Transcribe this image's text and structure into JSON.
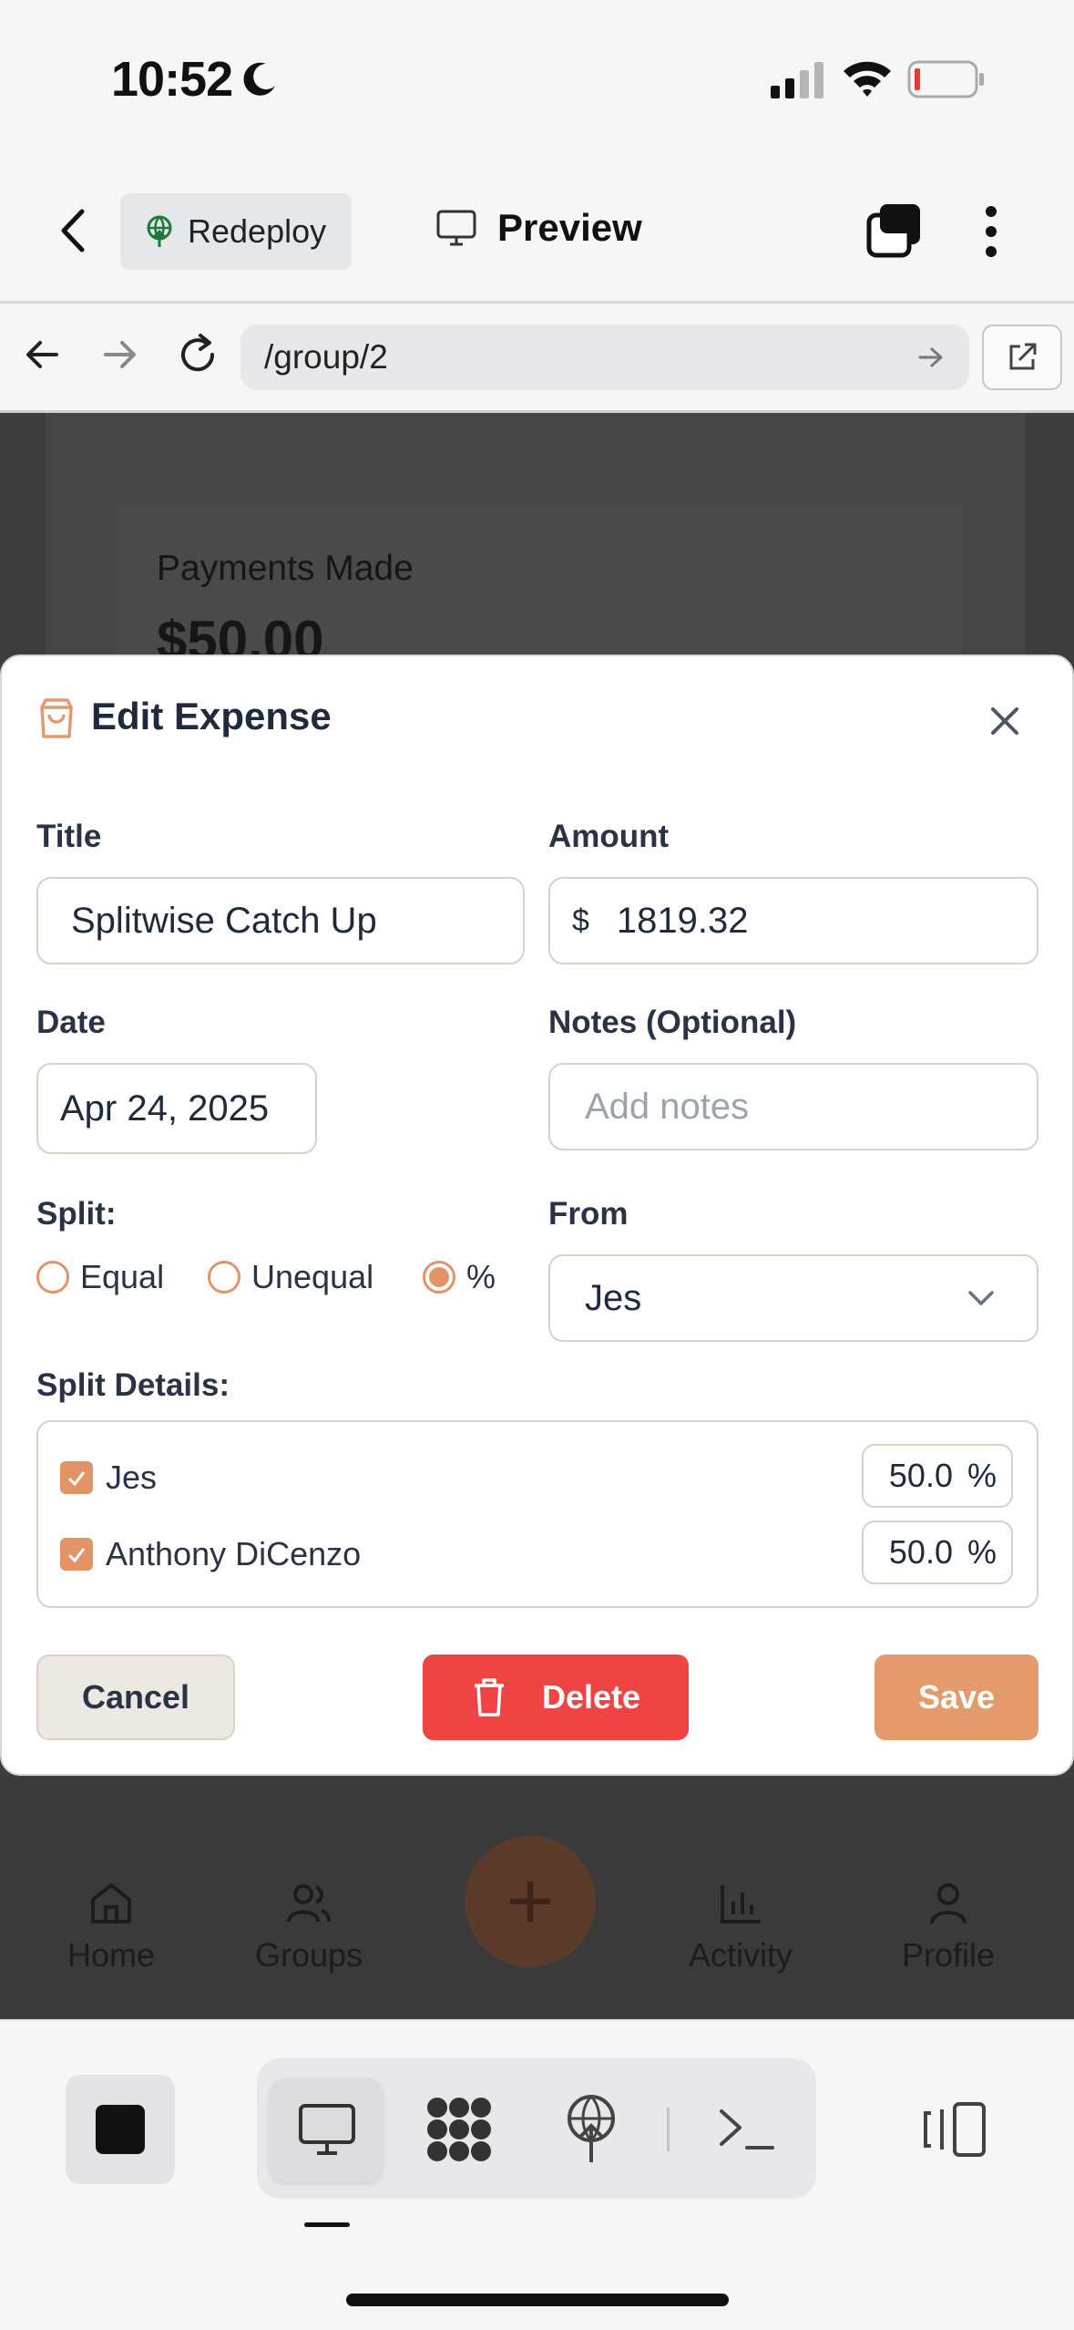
{
  "status": {
    "time": "10:52"
  },
  "header": {
    "redeploy_label": "Redeploy",
    "preview_label": "Preview"
  },
  "browser": {
    "url": "/group/2"
  },
  "background_page": {
    "payments_label": "Payments Made",
    "payments_value": "$50.00"
  },
  "modal": {
    "title": "Edit Expense",
    "title_label": "Title",
    "title_value": "Splitwise Catch Up",
    "amount_label": "Amount",
    "currency_symbol": "$",
    "amount_value": "1819.32",
    "date_label": "Date",
    "date_value": "Apr 24, 2025",
    "notes_label": "Notes (Optional)",
    "notes_placeholder": "Add notes",
    "split_label": "Split:",
    "split_options": [
      {
        "label": "Equal",
        "checked": false
      },
      {
        "label": "Unequal",
        "checked": false
      },
      {
        "label": "%",
        "checked": true
      }
    ],
    "from_label": "From",
    "from_value": "Jes",
    "split_details_label": "Split Details:",
    "split_details": [
      {
        "name": "Jes",
        "checked": true,
        "percent": "50.0",
        "unit": "%"
      },
      {
        "name": "Anthony DiCenzo",
        "checked": true,
        "percent": "50.0",
        "unit": "%"
      }
    ],
    "cancel_label": "Cancel",
    "delete_label": "Delete",
    "save_label": "Save"
  },
  "app_nav": {
    "items": [
      {
        "label": "Home",
        "icon": "home-icon"
      },
      {
        "label": "Groups",
        "icon": "users-icon"
      },
      {
        "label": "Activity",
        "icon": "bar-chart-icon"
      },
      {
        "label": "Profile",
        "icon": "user-icon"
      }
    ],
    "fab_symbol": "+"
  },
  "colors": {
    "accent": "#e49a6c",
    "danger": "#ef4444",
    "text": "#1f2a3c",
    "overlay": "#3d3d3d"
  }
}
